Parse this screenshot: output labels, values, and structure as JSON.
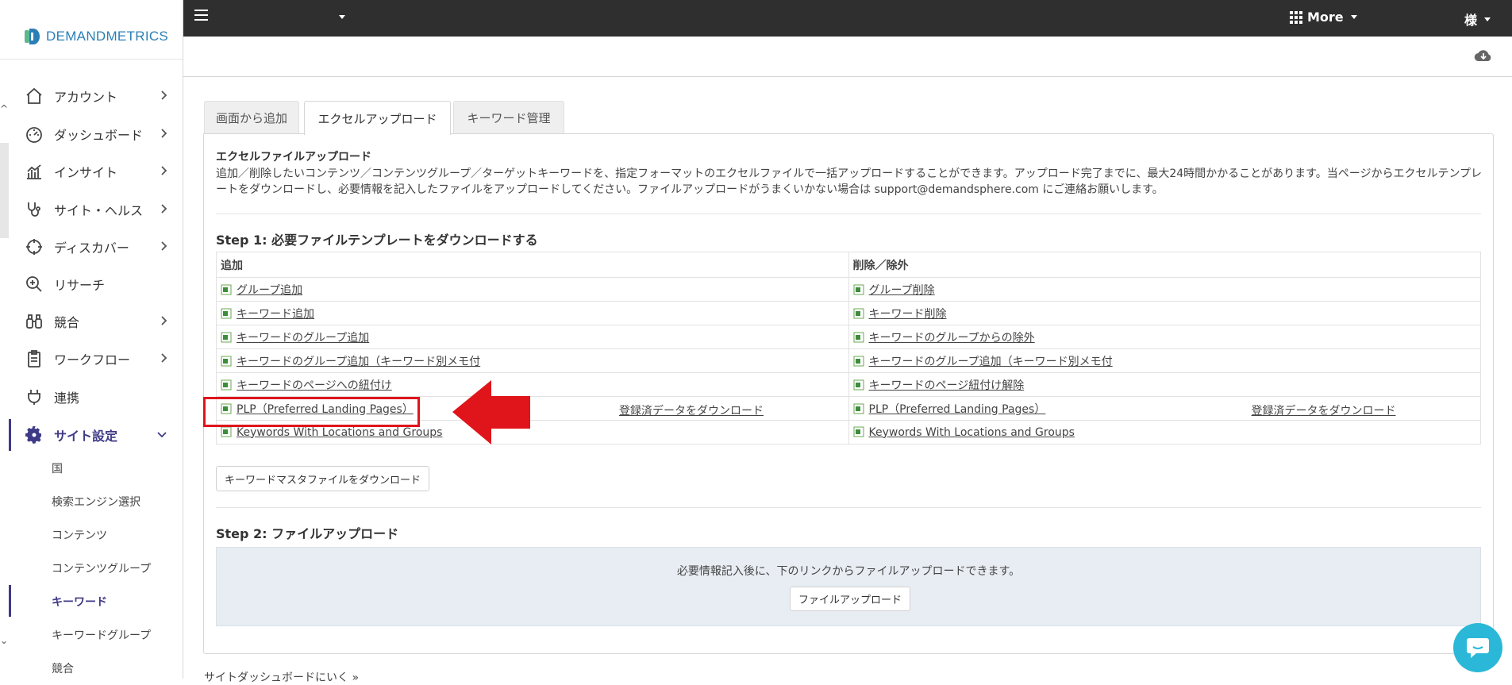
{
  "brand": {
    "name": "DEMANDMETRICS"
  },
  "topbar": {
    "more_label": "More",
    "user_label": "様"
  },
  "sidebar": {
    "items": [
      {
        "label": "アカウント",
        "icon": "home-icon"
      },
      {
        "label": "ダッシュボード",
        "icon": "gauge-icon"
      },
      {
        "label": "インサイト",
        "icon": "chart-icon"
      },
      {
        "label": "サイト・ヘルス",
        "icon": "stethoscope-icon"
      },
      {
        "label": "ディスカバー",
        "icon": "crosshair-icon"
      },
      {
        "label": "リサーチ",
        "icon": "zoom-icon"
      },
      {
        "label": "競合",
        "icon": "binoculars-icon"
      },
      {
        "label": "ワークフロー",
        "icon": "clipboard-icon"
      },
      {
        "label": "連携",
        "icon": "plug-icon"
      },
      {
        "label": "サイト設定",
        "icon": "gear-icon"
      }
    ],
    "subitems": [
      {
        "label": "国"
      },
      {
        "label": "検索エンジン選択"
      },
      {
        "label": "コンテンツ"
      },
      {
        "label": "コンテンツグループ"
      },
      {
        "label": "キーワード"
      },
      {
        "label": "キーワードグループ"
      },
      {
        "label": "競合"
      }
    ]
  },
  "tabs": [
    {
      "label": "画面から追加"
    },
    {
      "label": "エクセルアップロード"
    },
    {
      "label": "キーワード管理"
    }
  ],
  "panel": {
    "title": "エクセルファイルアップロード",
    "description": "追加／削除したいコンテンツ／コンテンツグループ／ターゲットキーワードを、指定フォーマットのエクセルファイルで一括アップロードすることができます。アップロード完了までに、最大24時間かかることがあります。当ページからエクセルテンプレートをダウンロードし、必要情報を記入したファイルをアップロードしてください。ファイルアップロードがうまくいかない場合は support@demandsphere.com にご連絡お願いします。",
    "step1_title": "Step 1: 必要ファイルテンプレートをダウンロードする",
    "table": {
      "headers": {
        "add": "追加",
        "remove": "削除／除外"
      },
      "rows": [
        {
          "add": "グループ追加",
          "remove": "グループ削除"
        },
        {
          "add": "キーワード追加",
          "remove": "キーワード削除"
        },
        {
          "add": "キーワードのグループ追加",
          "remove": "キーワードのグループからの除外"
        },
        {
          "add": "キーワードのグループ追加（キーワード別メモ付",
          "remove": "キーワードのグループ追加（キーワード別メモ付"
        },
        {
          "add": "キーワードのページへの紐付け",
          "remove": "キーワードのページ紐付け解除"
        },
        {
          "add": "PLP（Preferred Landing Pages）",
          "add_extra": "登録済データをダウンロード",
          "remove": "PLP（Preferred Landing Pages）",
          "remove_extra": "登録済データをダウンロード"
        },
        {
          "add": "Keywords With Locations and Groups",
          "remove": "Keywords With Locations and Groups"
        }
      ]
    },
    "master_button": "キーワードマスタファイルをダウンロード",
    "step2_title": "Step 2: ファイルアップロード",
    "upload_text": "必要情報記入後に、下のリンクからファイルアップロードできます。",
    "upload_button": "ファイルアップロード"
  },
  "footer_link": "サイトダッシュボードにいく »",
  "colors": {
    "accent": "#3f3a86",
    "topbar": "#2f2f2f",
    "highlight": "#e0141b",
    "chat": "#2bb8d8"
  }
}
